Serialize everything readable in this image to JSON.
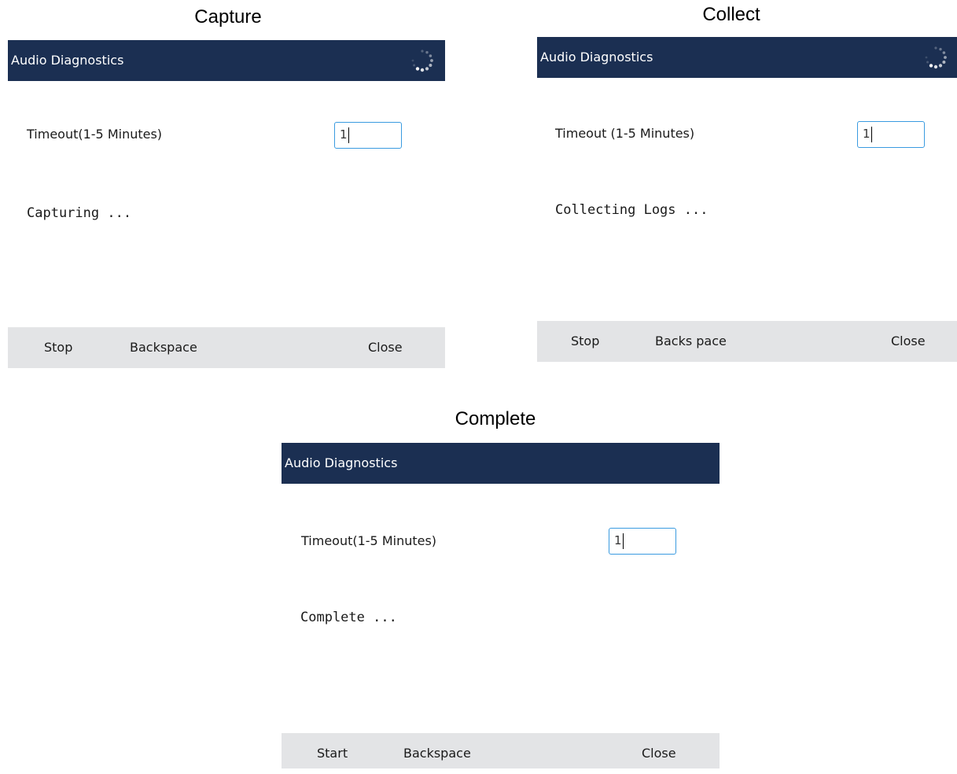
{
  "panels": [
    {
      "caption": "Capture",
      "header_title": "Audio Diagnostics",
      "show_spinner": true,
      "timeout_label": "Timeout(1-5 Minutes)",
      "timeout_value": "1",
      "status": "Capturing ...",
      "softkeys": [
        "Stop",
        "Backspace",
        "Close"
      ]
    },
    {
      "caption": "Collect",
      "header_title": "Audio Diagnostics",
      "show_spinner": true,
      "timeout_label": "Timeout (1-5 Minutes)",
      "timeout_value": "1",
      "status": "Collecting Logs ...",
      "softkeys": [
        "Stop",
        "Backs pace",
        "Close"
      ]
    },
    {
      "caption": "Complete",
      "header_title": "Audio Diagnostics",
      "show_spinner": false,
      "timeout_label": "Timeout(1-5 Minutes)",
      "timeout_value": "1",
      "status": "Complete ...",
      "softkeys": [
        "Start",
        "Backspace",
        "Close"
      ]
    }
  ],
  "icons": {
    "spinner": "loading-spinner-icon"
  },
  "colors": {
    "header_bg": "#1b2f52",
    "softkey_bg": "#e3e4e6",
    "input_border": "#3a9be0"
  }
}
